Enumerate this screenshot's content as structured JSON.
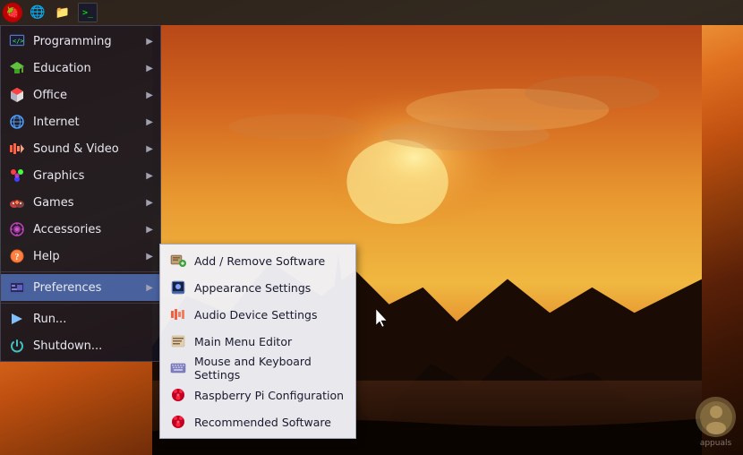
{
  "taskbar": {
    "icons": [
      {
        "name": "raspberry-pi-icon",
        "symbol": "🍓"
      },
      {
        "name": "globe-icon",
        "symbol": "🌐"
      },
      {
        "name": "folder-icon",
        "symbol": "📁"
      },
      {
        "name": "terminal-icon",
        "symbol": "⌨"
      }
    ]
  },
  "menu": {
    "items": [
      {
        "id": "programming",
        "label": "Programming",
        "icon": "💻",
        "has_submenu": true
      },
      {
        "id": "education",
        "label": "Education",
        "icon": "🎓",
        "has_submenu": true
      },
      {
        "id": "office",
        "label": "Office",
        "icon": "📄",
        "has_submenu": true
      },
      {
        "id": "internet",
        "label": "Internet",
        "icon": "🌐",
        "has_submenu": true
      },
      {
        "id": "sound-video",
        "label": "Sound & Video",
        "icon": "🎵",
        "has_submenu": true
      },
      {
        "id": "graphics",
        "label": "Graphics",
        "icon": "🖼",
        "has_submenu": true
      },
      {
        "id": "games",
        "label": "Games",
        "icon": "🎮",
        "has_submenu": true
      },
      {
        "id": "accessories",
        "label": "Accessories",
        "icon": "🔧",
        "has_submenu": true
      },
      {
        "id": "help",
        "label": "Help",
        "icon": "❓",
        "has_submenu": true
      }
    ],
    "active_item": "preferences",
    "active_label": "Preferences",
    "active_icon": "⚙",
    "bottom_items": [
      {
        "id": "run",
        "label": "Run...",
        "icon": "▶"
      },
      {
        "id": "shutdown",
        "label": "Shutdown...",
        "icon": "⏻"
      }
    ]
  },
  "submenu": {
    "title": "Preferences",
    "items": [
      {
        "id": "add-remove",
        "label": "Add / Remove Software",
        "icon": "📦"
      },
      {
        "id": "appearance",
        "label": "Appearance Settings",
        "icon": "🖥"
      },
      {
        "id": "audio",
        "label": "Audio Device Settings",
        "icon": "🔊"
      },
      {
        "id": "main-menu",
        "label": "Main Menu Editor",
        "icon": "📋"
      },
      {
        "id": "mouse-keyboard",
        "label": "Mouse and Keyboard Settings",
        "icon": "⌨"
      },
      {
        "id": "raspberry-config",
        "label": "Raspberry Pi Configuration",
        "icon": "🍓"
      },
      {
        "id": "recommended",
        "label": "Recommended Software",
        "icon": "🍓"
      }
    ]
  }
}
